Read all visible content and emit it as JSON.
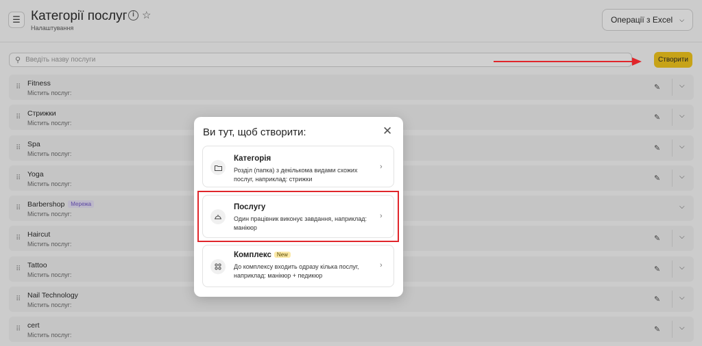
{
  "header": {
    "title": "Категорії послуг",
    "subtitle": "Налаштування",
    "menu_icon": "hamburger-icon",
    "info_icon": "i",
    "excel_button": "Операції з Excel"
  },
  "search": {
    "placeholder": "Введіть назву послуги"
  },
  "create_button": "Створити",
  "categories": [
    {
      "name": "Fitness",
      "sub": "Містить послуг:",
      "badge": ""
    },
    {
      "name": "Стрижки",
      "sub": "Містить послуг:",
      "badge": ""
    },
    {
      "name": "Spa",
      "sub": "Містить послуг:",
      "badge": ""
    },
    {
      "name": "Yoga",
      "sub": "Містить послуг:",
      "badge": ""
    },
    {
      "name": "Barbershop",
      "sub": "Містить послуг:",
      "badge": "Мережа"
    },
    {
      "name": "Haircut",
      "sub": "Містить послуг:",
      "badge": ""
    },
    {
      "name": "Tattoo",
      "sub": "Містить послуг:",
      "badge": ""
    },
    {
      "name": "Nail Technology",
      "sub": "Містить послуг:",
      "badge": ""
    },
    {
      "name": "cert",
      "sub": "Містить послуг:",
      "badge": ""
    }
  ],
  "modal": {
    "title": "Ви тут, щоб створити:",
    "options": [
      {
        "title": "Категорія",
        "desc": "Розділ (папка) з декількома видами схожих послуг, наприклад: стрижки",
        "badge": "",
        "icon": "folder-icon"
      },
      {
        "title": "Послугу",
        "desc": "Один працівник виконує завдання, наприклад: манікюр",
        "badge": "",
        "icon": "service-bell-icon"
      },
      {
        "title": "Комплекс",
        "desc": "До комплексу входить одразу кілька послуг, наприклад: манікюр + педикюр",
        "badge": "New",
        "icon": "grid-icon"
      }
    ]
  },
  "colors": {
    "accent": "#f4c614",
    "annotation": "#e0252a"
  }
}
